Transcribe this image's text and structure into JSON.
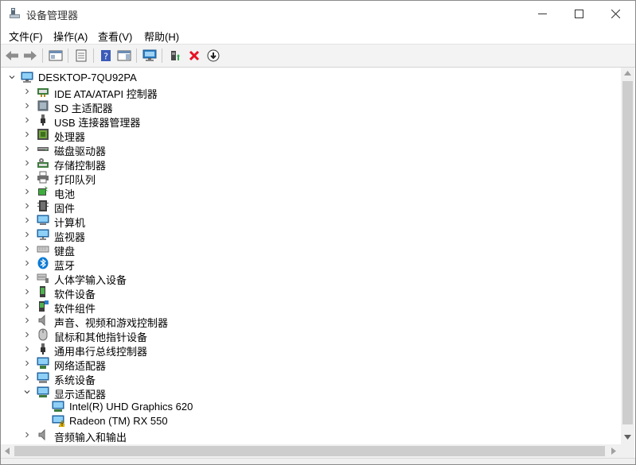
{
  "window": {
    "title": "设备管理器"
  },
  "menu": [
    {
      "label": "文件(F)"
    },
    {
      "label": "操作(A)"
    },
    {
      "label": "查看(V)"
    },
    {
      "label": "帮助(H)"
    }
  ],
  "toolbar": {
    "buttons": [
      {
        "icon": "back-arrow-icon"
      },
      {
        "icon": "forward-arrow-icon"
      },
      {
        "icon": "show-hide-console-tree-icon"
      },
      {
        "icon": "properties-icon"
      },
      {
        "icon": "help-icon"
      },
      {
        "icon": "action-pane-icon"
      },
      {
        "icon": "scan-hardware-icon"
      },
      {
        "icon": "update-driver-icon"
      },
      {
        "icon": "uninstall-device-icon"
      },
      {
        "icon": "download-driver-icon"
      }
    ]
  },
  "tree": {
    "root": {
      "label": "DESKTOP-7QU92PA",
      "icon": "computer-icon"
    },
    "items": [
      {
        "label": "IDE ATA/ATAPI 控制器",
        "icon": "ide-controller-icon"
      },
      {
        "label": "SD 主适配器",
        "icon": "sd-host-adapter-icon"
      },
      {
        "label": "USB 连接器管理器",
        "icon": "usb-icon"
      },
      {
        "label": "处理器",
        "icon": "processor-icon"
      },
      {
        "label": "磁盘驱动器",
        "icon": "disk-drive-icon"
      },
      {
        "label": "存储控制器",
        "icon": "storage-controller-icon"
      },
      {
        "label": "打印队列",
        "icon": "printer-icon"
      },
      {
        "label": "电池",
        "icon": "battery-icon"
      },
      {
        "label": "固件",
        "icon": "firmware-icon"
      },
      {
        "label": "计算机",
        "icon": "computer-monitor-icon"
      },
      {
        "label": "监视器",
        "icon": "monitor-icon"
      },
      {
        "label": "键盘",
        "icon": "keyboard-icon"
      },
      {
        "label": "蓝牙",
        "icon": "bluetooth-icon"
      },
      {
        "label": "人体学输入设备",
        "icon": "hid-icon"
      },
      {
        "label": "软件设备",
        "icon": "software-device-icon"
      },
      {
        "label": "软件组件",
        "icon": "software-component-icon"
      },
      {
        "label": "声音、视频和游戏控制器",
        "icon": "speaker-icon"
      },
      {
        "label": "鼠标和其他指针设备",
        "icon": "mouse-icon"
      },
      {
        "label": "通用串行总线控制器",
        "icon": "usb-controller-icon"
      },
      {
        "label": "网络适配器",
        "icon": "network-adapter-icon"
      },
      {
        "label": "系统设备",
        "icon": "system-device-icon"
      },
      {
        "label": "显示适配器",
        "icon": "display-adapter-icon",
        "expanded": true,
        "children": [
          {
            "label": "Intel(R) UHD Graphics 620",
            "icon": "display-adapter-icon"
          },
          {
            "label": "Radeon (TM) RX 550",
            "icon": "display-adapter-warning-icon"
          }
        ]
      },
      {
        "label": "音频输入和输出",
        "icon": "audio-io-icon"
      }
    ]
  },
  "colors": {
    "accent": "#0078d7",
    "warning": "#f5c400",
    "error": "#e81123"
  }
}
